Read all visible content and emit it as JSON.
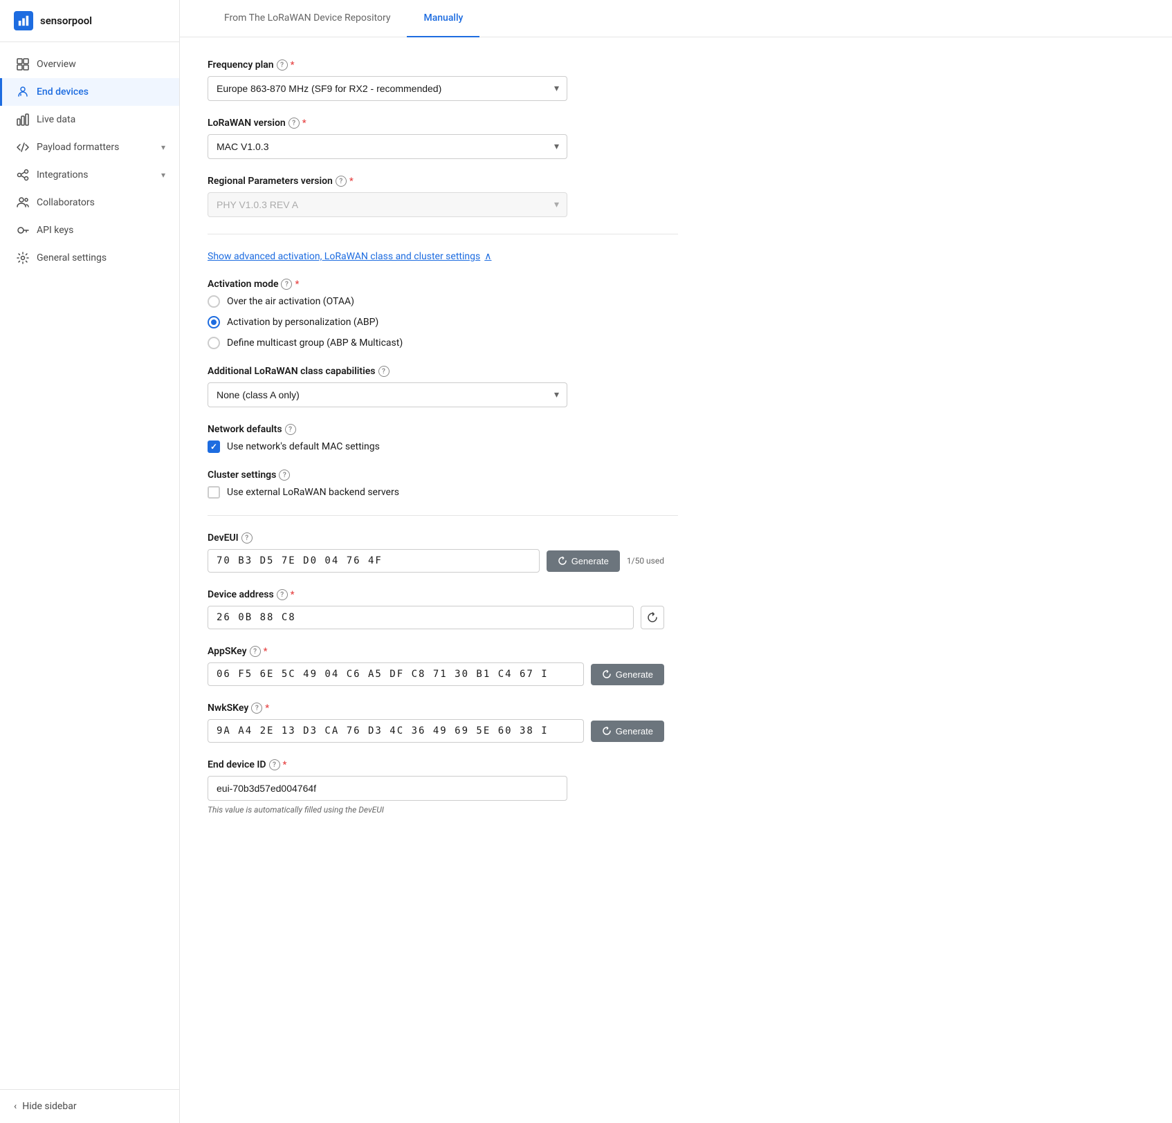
{
  "app": {
    "name": "sensorpool"
  },
  "sidebar": {
    "nav_items": [
      {
        "id": "overview",
        "label": "Overview",
        "icon": "grid-icon",
        "active": false
      },
      {
        "id": "end-devices",
        "label": "End devices",
        "icon": "devices-icon",
        "active": true
      },
      {
        "id": "live-data",
        "label": "Live data",
        "icon": "chart-icon",
        "active": false
      },
      {
        "id": "payload-formatters",
        "label": "Payload formatters",
        "icon": "code-icon",
        "active": false,
        "expandable": true
      },
      {
        "id": "integrations",
        "label": "Integrations",
        "icon": "integration-icon",
        "active": false,
        "expandable": true
      },
      {
        "id": "collaborators",
        "label": "Collaborators",
        "icon": "people-icon",
        "active": false
      },
      {
        "id": "api-keys",
        "label": "API keys",
        "icon": "key-icon",
        "active": false
      },
      {
        "id": "general-settings",
        "label": "General settings",
        "icon": "settings-icon",
        "active": false
      }
    ],
    "footer": {
      "label": "Hide sidebar",
      "icon": "chevron-left-icon"
    }
  },
  "tabs": [
    {
      "id": "from-repo",
      "label": "From The LoRaWAN Device Repository",
      "active": false
    },
    {
      "id": "manually",
      "label": "Manually",
      "active": true
    }
  ],
  "form": {
    "frequency_plan": {
      "label": "Frequency plan",
      "required": true,
      "value": "Europe 863-870 MHz (SF9 for RX2 - recommended)"
    },
    "lorawan_version": {
      "label": "LoRaWAN version",
      "required": true,
      "value": "MAC V1.0.3"
    },
    "regional_params": {
      "label": "Regional Parameters version",
      "required": true,
      "value": "PHY V1.0.3 REV A",
      "disabled": true
    },
    "advanced_link": "Show advanced activation, LoRaWAN class and cluster settings",
    "activation_mode": {
      "label": "Activation mode",
      "required": true,
      "options": [
        {
          "id": "otaa",
          "label": "Over the air activation (OTAA)",
          "checked": false
        },
        {
          "id": "abp",
          "label": "Activation by personalization (ABP)",
          "checked": true
        },
        {
          "id": "multicast",
          "label": "Define multicast group (ABP & Multicast)",
          "checked": false
        }
      ]
    },
    "lorawan_class": {
      "label": "Additional LoRaWAN class capabilities",
      "value": "None (class A only)"
    },
    "network_defaults": {
      "label": "Network defaults",
      "checkbox_label": "Use network's default MAC settings",
      "checked": true
    },
    "cluster_settings": {
      "label": "Cluster settings",
      "checkbox_label": "Use external LoRaWAN backend servers",
      "checked": false
    },
    "dev_eui": {
      "label": "DevEUI",
      "value": "70  B3  D5  7E  D0  04  76  4F",
      "used": "1/50 used",
      "generate_label": "Generate"
    },
    "device_address": {
      "label": "Device address",
      "required": true,
      "value": "26  0B  88  C8"
    },
    "apps_key": {
      "label": "AppSKey",
      "required": true,
      "value": "06  F5  6E  5C  49  04  C6  A5  DF  C8  71  30  B1  C4  67  I",
      "generate_label": "Generate"
    },
    "nwks_key": {
      "label": "NwkSKey",
      "required": true,
      "value": "9A  A4  2E  13  D3  CA  76  D3  4C  36  49  69  5E  60  38  I",
      "generate_label": "Generate"
    },
    "end_device_id": {
      "label": "End device ID",
      "required": true,
      "value": "eui-70b3d57ed004764f",
      "hint": "This value is automatically filled using the DevEUI"
    }
  }
}
